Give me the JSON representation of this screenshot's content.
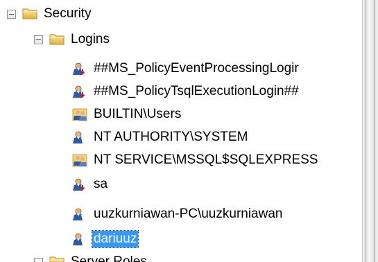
{
  "tree": {
    "security": {
      "label": "Security",
      "icon": "folder-icon"
    },
    "logins": {
      "label": "Logins",
      "icon": "folder-icon"
    },
    "items": [
      {
        "label": "##MS_PolicyEventProcessingLogir",
        "icon": "login-disabled-icon"
      },
      {
        "label": "##MS_PolicyTsqlExecutionLogin##",
        "icon": "login-disabled-icon"
      },
      {
        "label": "BUILTIN\\Users",
        "icon": "login-group-icon"
      },
      {
        "label": "NT AUTHORITY\\SYSTEM",
        "icon": "login-icon"
      },
      {
        "label": "NT SERVICE\\MSSQL$SQLEXPRESS",
        "icon": "login-group-icon"
      },
      {
        "label": "sa",
        "icon": "login-disabled-icon"
      },
      {
        "label": "uuzkurniawan-PC\\uuzkurniawan",
        "icon": "login-icon"
      },
      {
        "label": "dariuuz",
        "icon": "login-icon",
        "selected": true
      }
    ],
    "next_folder": {
      "label": "Server Roles",
      "icon": "folder-icon"
    }
  },
  "colors": {
    "selection": "#3399ff",
    "folder": "#f2c94c"
  }
}
